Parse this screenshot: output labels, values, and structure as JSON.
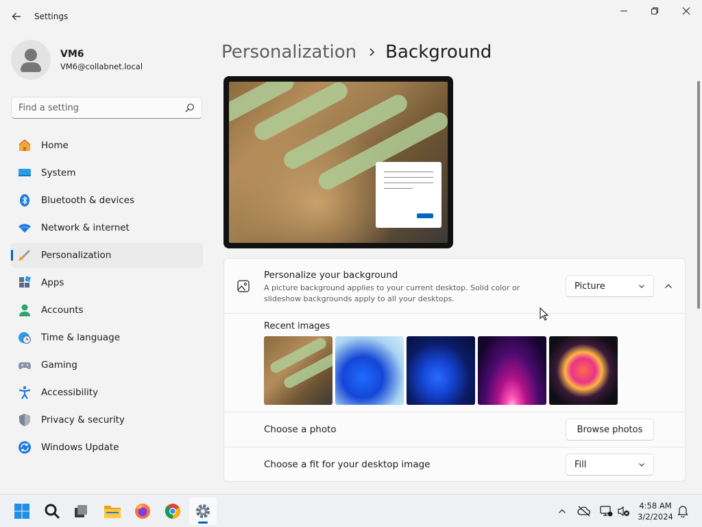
{
  "window": {
    "title": "Settings"
  },
  "profile": {
    "name": "VM6",
    "email": "VM6@collabnet.local"
  },
  "search": {
    "placeholder": "Find a setting"
  },
  "nav": {
    "items": [
      {
        "label": "Home",
        "icon": "home-icon"
      },
      {
        "label": "System",
        "icon": "monitor-icon"
      },
      {
        "label": "Bluetooth & devices",
        "icon": "bluetooth-icon"
      },
      {
        "label": "Network & internet",
        "icon": "wifi-icon"
      },
      {
        "label": "Personalization",
        "icon": "brush-icon",
        "active": true
      },
      {
        "label": "Apps",
        "icon": "apps-icon"
      },
      {
        "label": "Accounts",
        "icon": "person-icon"
      },
      {
        "label": "Time & language",
        "icon": "globe-clock-icon"
      },
      {
        "label": "Gaming",
        "icon": "gamepad-icon"
      },
      {
        "label": "Accessibility",
        "icon": "accessibility-icon"
      },
      {
        "label": "Privacy & security",
        "icon": "shield-icon"
      },
      {
        "label": "Windows Update",
        "icon": "update-icon"
      }
    ]
  },
  "breadcrumb": {
    "parent": "Personalization",
    "current": "Background"
  },
  "background": {
    "title": "Personalize your background",
    "description": "A picture background applies to your current desktop. Solid color or slideshow backgrounds apply to all your desktops.",
    "type_value": "Picture",
    "recent_label": "Recent images",
    "recent_images": [
      "custom-photo-thumbnail",
      "windows-bloom-light-thumbnail",
      "windows-bloom-dark-thumbnail",
      "glow-arc-thumbnail",
      "flower-abstract-thumbnail"
    ],
    "choose_photo_label": "Choose a photo",
    "browse_label": "Browse photos",
    "fit_label": "Choose a fit for your desktop image",
    "fit_value": "Fill"
  },
  "taskbar": {
    "apps": [
      "start-icon",
      "search-icon",
      "task-view-icon",
      "file-explorer-icon",
      "firefox-icon",
      "chrome-icon",
      "settings-icon"
    ],
    "active_app": "settings-icon",
    "time": "4:58 AM",
    "date": "3/2/2024"
  },
  "colors": {
    "accent": "#005fb8",
    "background": "#f3f3f3",
    "card": "#fbfbfb"
  }
}
